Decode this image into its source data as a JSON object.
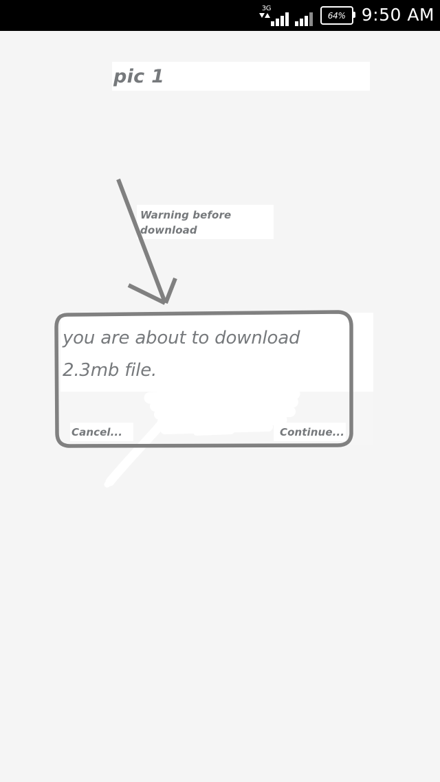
{
  "status_bar": {
    "network_type": "3G",
    "battery_percent": "64%",
    "clock": "9:50 AM",
    "signal_icon": "signal-bars-icon",
    "data_icon": "data-transfer-arrows-icon",
    "battery_icon": "battery-icon",
    "background_color": "#000000",
    "foreground_color": "#ffffff"
  },
  "annotations": {
    "caption": "pic 1",
    "warning_label": "Warning before download",
    "arrow_icon": "arrow-pointing-down-icon",
    "scribble_icon": "white-eraser-scribble-icon",
    "highlight_icon": "hand-drawn-rounded-rectangle-icon",
    "annotation_color": "#808080",
    "text_color": "#76797c"
  },
  "dialog": {
    "message": "you are about to download 2.3mb file.",
    "cancel_label": "Cancel...",
    "continue_label": "Continue...",
    "body_background": "#ffffff",
    "footer_background": "#f6f6f6"
  },
  "page": {
    "background_color": "#f5f5f5"
  }
}
